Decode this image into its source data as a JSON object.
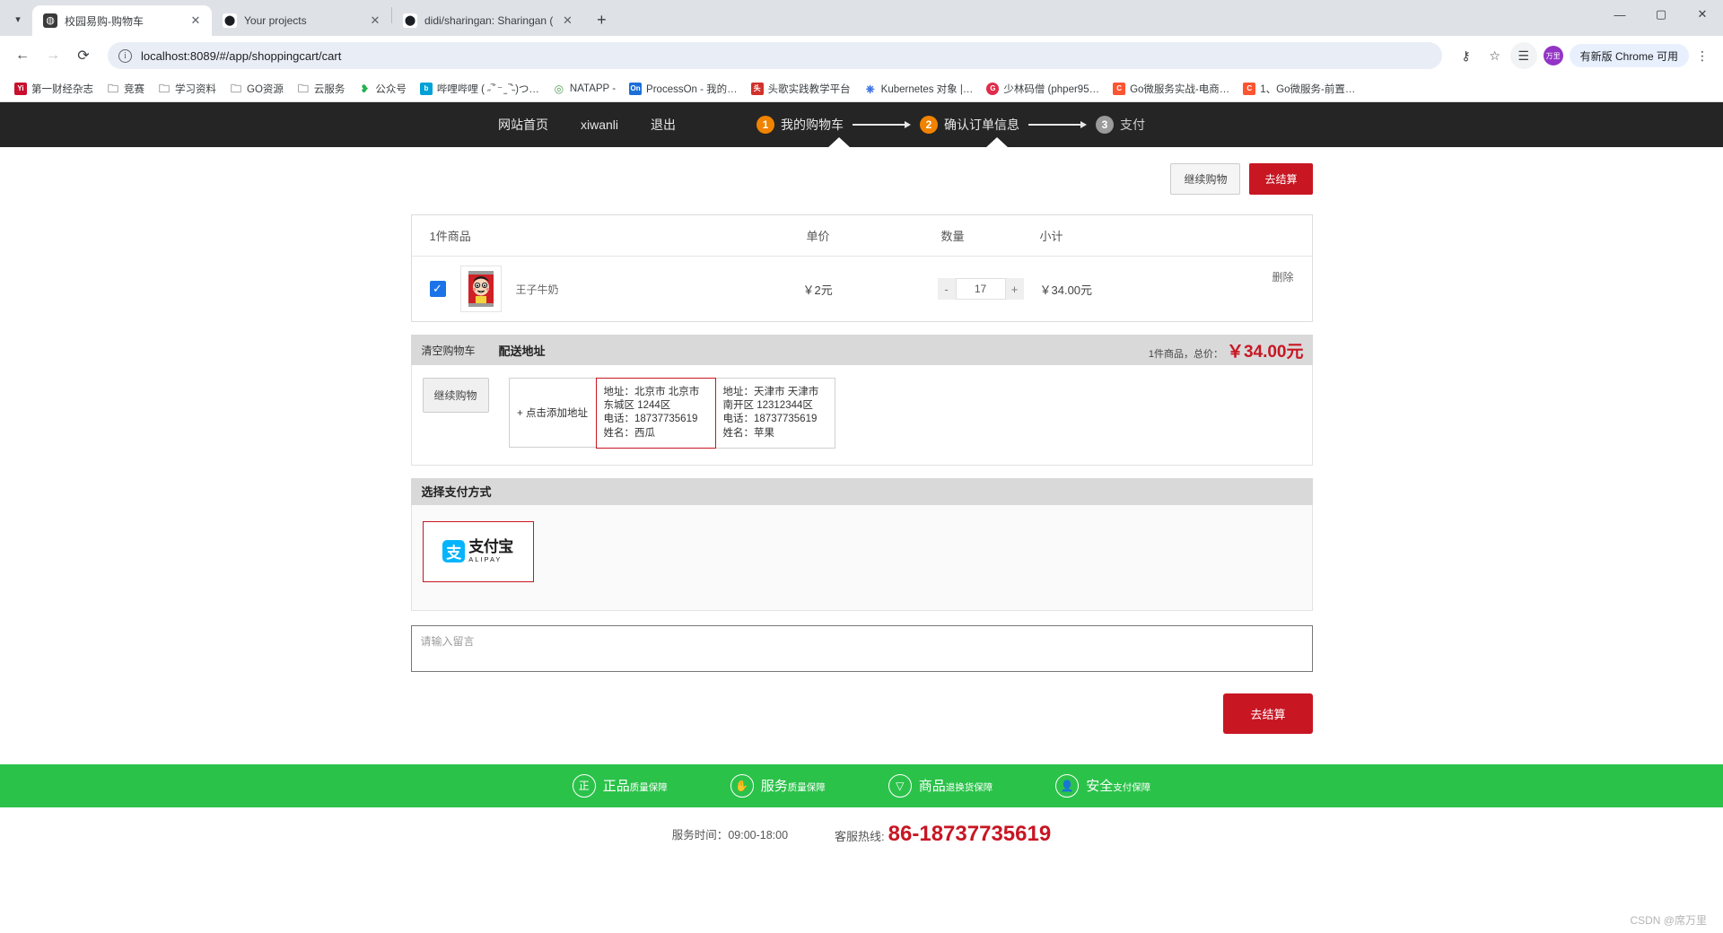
{
  "browser": {
    "tabs": [
      {
        "title": "校园易购-购物车",
        "favicon": "globe-icon",
        "active": true
      },
      {
        "title": "Your projects",
        "favicon": "github-icon",
        "active": false
      },
      {
        "title": "didi/sharingan: Sharingan (",
        "favicon": "github-icon",
        "active": false
      }
    ],
    "newtab_label": "+",
    "tab_list_icon": "chevron-down-icon",
    "back_icon": "←",
    "forward_icon": "→",
    "reload_icon": "⟳",
    "url": "localhost:8089/#/app/shoppingcart/cart",
    "site_info_icon": "ⓘ",
    "right_icons": [
      "key-icon",
      "star-icon",
      "reading-list-icon"
    ],
    "avatar_label": "万里",
    "update_chip": "有新版 Chrome 可用",
    "kebab_icon": "⋮",
    "window_controls": [
      "minimize",
      "maximize",
      "close"
    ],
    "bookmarks": [
      {
        "label": "第一财经杂志",
        "icon": "Yi",
        "color": "#c8102e"
      },
      {
        "label": "竞赛",
        "icon": "folder",
        "color": "#9aa0a6"
      },
      {
        "label": "学习资料",
        "icon": "folder",
        "color": "#9aa0a6"
      },
      {
        "label": "GO资源",
        "icon": "folder",
        "color": "#9aa0a6"
      },
      {
        "label": "云服务",
        "icon": "folder",
        "color": "#9aa0a6"
      },
      {
        "label": "公众号",
        "icon": "leaf",
        "color": "#22b14c"
      },
      {
        "label": "哔哩哔哩 ( ˶‾᷄ ⁻ ̫ ‾᷅˵)つ…",
        "icon": "bili",
        "color": "#00a1d6"
      },
      {
        "label": "NATAPP -",
        "icon": "ring",
        "color": "#4f9d54"
      },
      {
        "label": "ProcessOn - 我的…",
        "icon": "On",
        "color": "#1c6fd8"
      },
      {
        "label": "头歌实践教学平台",
        "icon": "tg",
        "color": "#d0322c"
      },
      {
        "label": "Kubernetes 对象 |…",
        "icon": "k8s",
        "color": "#326ce5"
      },
      {
        "label": "少林码僧 (phper95…",
        "icon": "G",
        "color": "#e02c4a"
      },
      {
        "label": "Go微服务实战-电商…",
        "icon": "C",
        "color": "#fc5531"
      },
      {
        "label": "1、Go微服务-前置…",
        "icon": "C",
        "color": "#fc5531"
      }
    ]
  },
  "site": {
    "nav": [
      {
        "label": "网站首页"
      },
      {
        "label": "xiwanli"
      },
      {
        "label": "退出"
      }
    ],
    "steps": [
      {
        "num": "1",
        "label": "我的购物车",
        "state": "active"
      },
      {
        "num": "2",
        "label": "确认订单信息",
        "state": "active"
      },
      {
        "num": "3",
        "label": "支付",
        "state": "inactive"
      }
    ]
  },
  "toolbar": {
    "continue_shopping": "继续购物",
    "checkout": "去结算"
  },
  "cart": {
    "headers": {
      "name": "1件商品",
      "price": "单价",
      "qty": "数量",
      "subtotal": "小计"
    },
    "rows": [
      {
        "checked": true,
        "name": "王子牛奶",
        "price": "￥2元",
        "qty": "17",
        "minus": "-",
        "plus": "+",
        "subtotal": "￥34.00元",
        "delete_label": "删除",
        "thumb": "milk-can-icon"
      }
    ]
  },
  "summary_band": {
    "clear_cart": "清空购物车",
    "title": "配送地址",
    "total_prefix": "1件商品，总价：",
    "total_value": "￥34.00元"
  },
  "address": {
    "continue_shopping": "继续购物",
    "add_label": "+ 点击添加地址",
    "items": [
      {
        "selected": true,
        "addr": "地址：北京市 北京市 东城区 1244区",
        "phone": "电话：18737735619",
        "name": "姓名：西瓜"
      },
      {
        "selected": false,
        "addr": "地址：天津市 天津市 南开区 12312344区",
        "phone": "电话：18737735619",
        "name": "姓名：苹果"
      }
    ]
  },
  "payment": {
    "title": "选择支付方式",
    "methods": [
      {
        "name": "支付宝",
        "en": "ALIPAY",
        "mark": "支",
        "selected": true
      }
    ]
  },
  "message": {
    "placeholder": "请输入留言",
    "value": ""
  },
  "bottom_checkout": "去结算",
  "guarantees": [
    {
      "icon": "正",
      "strong": "正品",
      "weak": "质量保障"
    },
    {
      "icon": "service-hands-icon",
      "strong": "服务",
      "weak": "质量保障"
    },
    {
      "icon": "box-return-icon",
      "strong": "商品",
      "weak": "退换货保障"
    },
    {
      "icon": "secure-person-icon",
      "strong": "安全",
      "weak": "支付保障"
    }
  ],
  "footer": {
    "hours_label": "服务时间：",
    "hours_value": "09:00-18:00",
    "hotline_label": "客服热线:",
    "hotline_number": "86-18737735619"
  },
  "watermark": "CSDN @席万里",
  "colors": {
    "brand_red": "#c81623",
    "step_active": "#f08300",
    "header_bg": "#252525",
    "green": "#2bc24a",
    "checkbox_blue": "#1a73e8"
  }
}
